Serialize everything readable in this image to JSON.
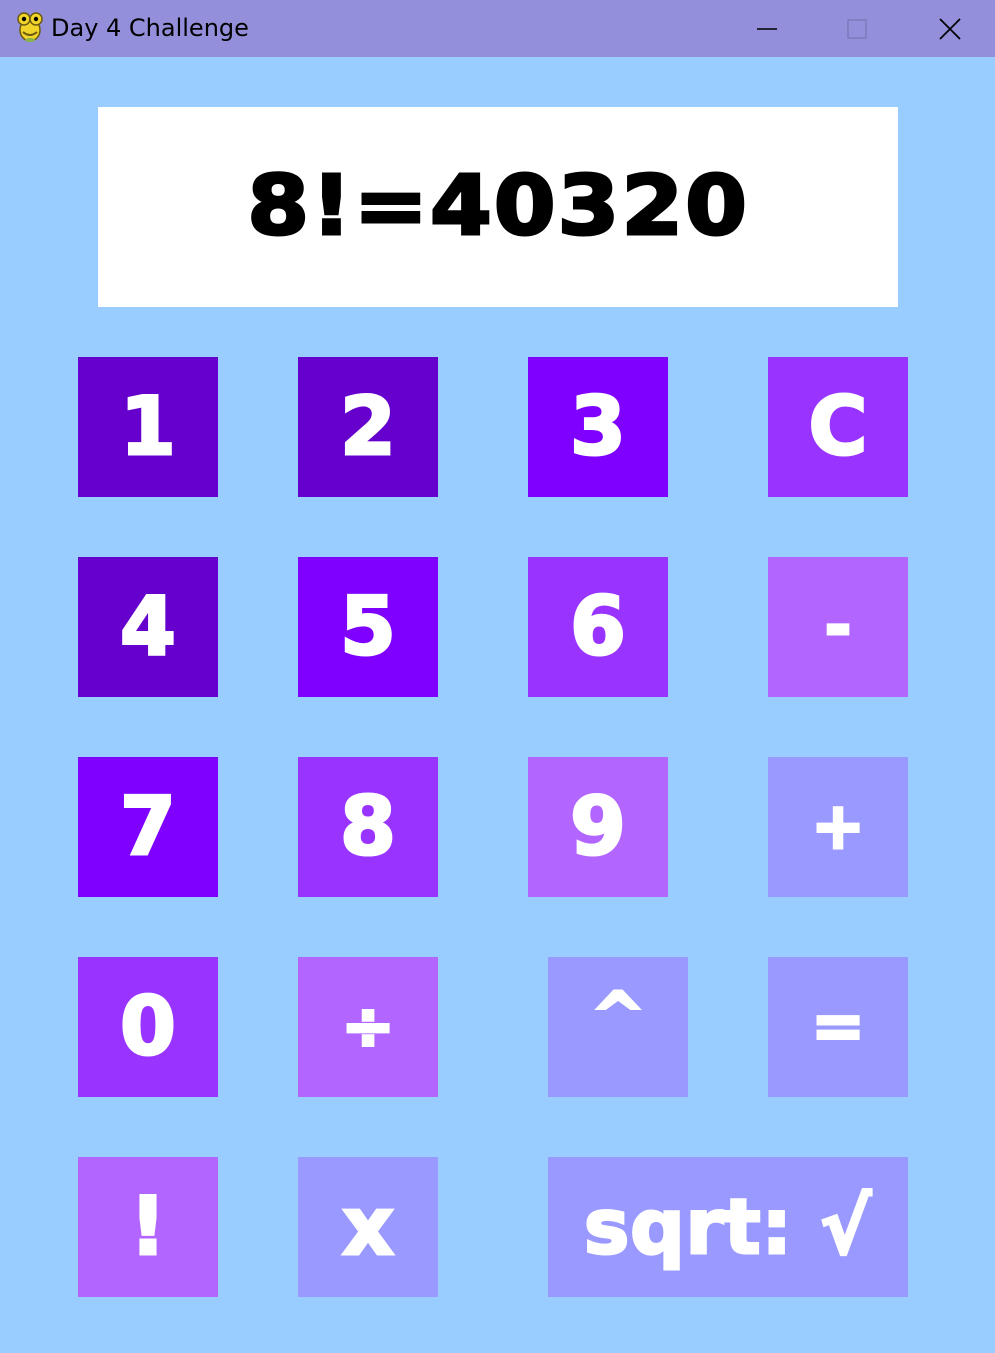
{
  "window": {
    "title": "Day 4 Challenge",
    "icon": "python-snake-icon"
  },
  "display": {
    "text": "8!=40320"
  },
  "colors": {
    "background": "#99ccff",
    "titlebar": "#938fdb",
    "display_bg": "#ffffff",
    "key_text": "#ffffff",
    "shade_1": "#6600cc",
    "shade_2": "#7f00ff",
    "shade_3": "#9933ff",
    "shade_4": "#b266ff",
    "shade_5": "#9999ff"
  },
  "keys": {
    "one": "1",
    "two": "2",
    "three": "3",
    "clear": "C",
    "four": "4",
    "five": "5",
    "six": "6",
    "minus": "-",
    "seven": "7",
    "eight": "8",
    "nine": "9",
    "plus": "+",
    "zero": "0",
    "divide": "÷",
    "power": "^",
    "equals": "=",
    "factorial": "!",
    "multiply": "x",
    "sqrt": "sqrt: √"
  }
}
